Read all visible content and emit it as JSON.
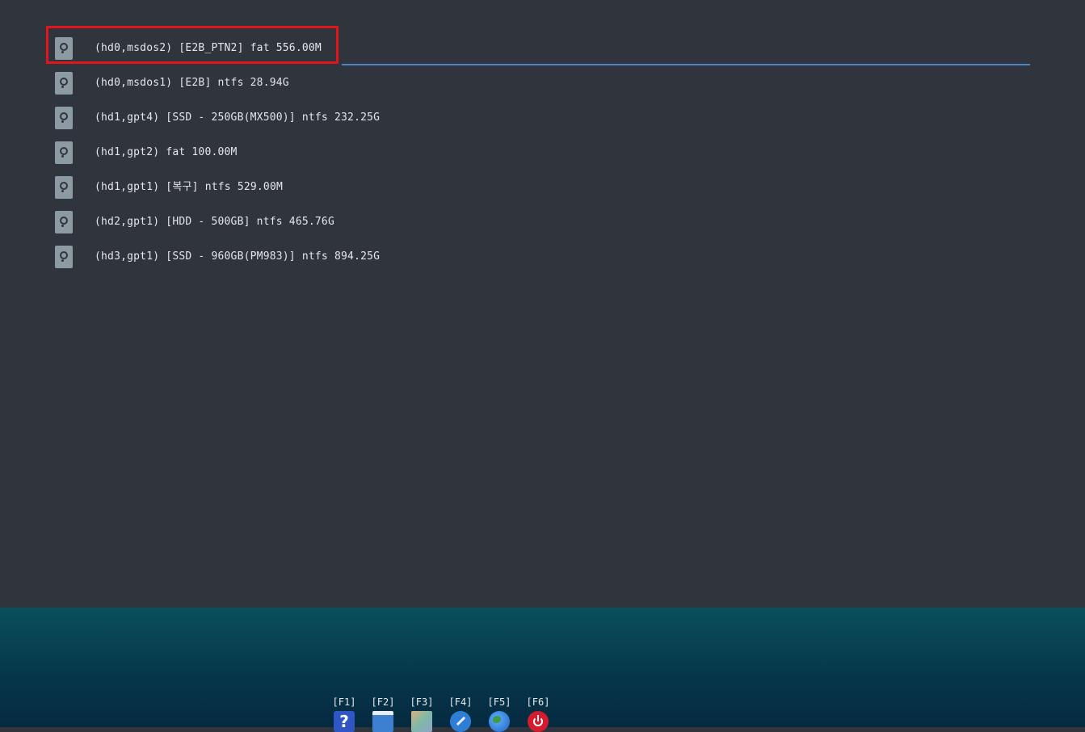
{
  "menu": {
    "selected_index": 0,
    "items": [
      {
        "label": "(hd0,msdos2) [E2B_PTN2] fat 556.00M",
        "icon": "hard-disk-icon"
      },
      {
        "label": "(hd0,msdos1) [E2B] ntfs 28.94G",
        "icon": "hard-disk-icon"
      },
      {
        "label": "(hd1,gpt4) [SSD - 250GB(MX500)] ntfs 232.25G",
        "icon": "hard-disk-icon"
      },
      {
        "label": "(hd1,gpt2) fat 100.00M",
        "icon": "hard-disk-icon"
      },
      {
        "label": "(hd1,gpt1) [복구] ntfs 529.00M",
        "icon": "hard-disk-icon"
      },
      {
        "label": "(hd2,gpt1) [HDD - 500GB] ntfs 465.76G",
        "icon": "hard-disk-icon"
      },
      {
        "label": "(hd3,gpt1) [SSD - 960GB(PM983)] ntfs 894.25G",
        "icon": "hard-disk-icon"
      }
    ]
  },
  "hotkeys": [
    {
      "key": "[F1]",
      "icon": "help-icon"
    },
    {
      "key": "[F2]",
      "icon": "window-icon"
    },
    {
      "key": "[F3]",
      "icon": "image-icon"
    },
    {
      "key": "[F4]",
      "icon": "tools-icon"
    },
    {
      "key": "[F5]",
      "icon": "globe-icon"
    },
    {
      "key": "[F6]",
      "icon": "power-icon"
    }
  ],
  "colors": {
    "background": "#30343d",
    "text": "#e3e6ea",
    "selection_underline": "#4a86c8",
    "highlight_box": "#e3141b",
    "taskbar_top": "#0a4f5c",
    "taskbar_bottom": "#052a40"
  }
}
